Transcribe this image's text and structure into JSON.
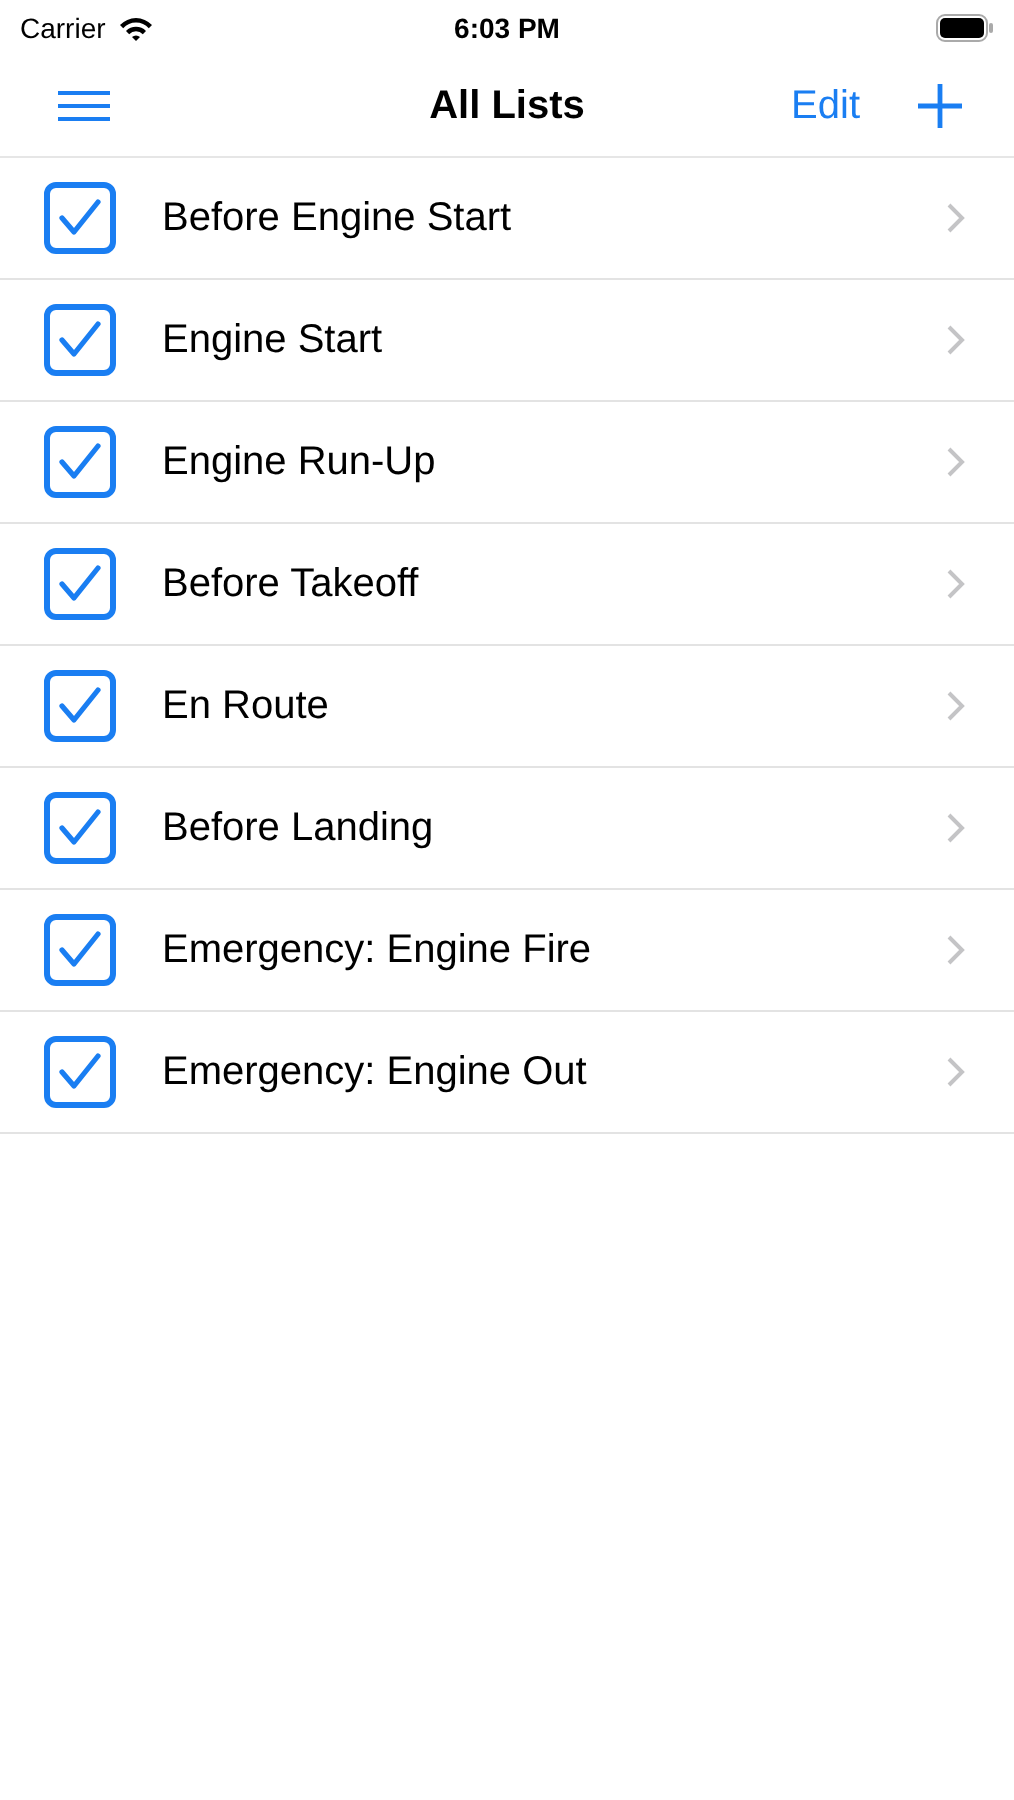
{
  "status_bar": {
    "carrier": "Carrier",
    "time": "6:03 PM"
  },
  "nav_bar": {
    "title": "All Lists",
    "edit": "Edit"
  },
  "lists": [
    {
      "name": "Before Engine Start",
      "checked": true
    },
    {
      "name": "Engine Start",
      "checked": true
    },
    {
      "name": "Engine Run-Up",
      "checked": true
    },
    {
      "name": "Before Takeoff",
      "checked": true
    },
    {
      "name": "En Route",
      "checked": true
    },
    {
      "name": "Before Landing",
      "checked": true
    },
    {
      "name": "Emergency: Engine Fire",
      "checked": true
    },
    {
      "name": "Emergency: Engine Out",
      "checked": true
    }
  ]
}
